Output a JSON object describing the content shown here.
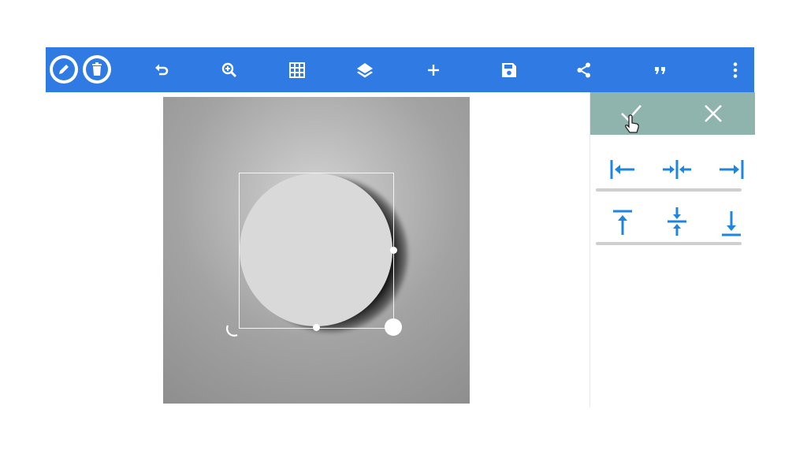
{
  "toolbar": {
    "accent": "#2f7ae3",
    "left_buttons": [
      {
        "name": "edit-button",
        "icon": "pencil-icon"
      },
      {
        "name": "delete-button",
        "icon": "trash-icon"
      }
    ],
    "buttons": [
      {
        "name": "undo-button",
        "icon": "undo-icon"
      },
      {
        "name": "zoom-button",
        "icon": "zoom-in-icon"
      },
      {
        "name": "grid-button",
        "icon": "grid-icon"
      },
      {
        "name": "layers-button",
        "icon": "layers-icon"
      },
      {
        "name": "add-button",
        "icon": "plus-icon"
      },
      {
        "name": "save-button",
        "icon": "save-icon"
      },
      {
        "name": "share-button",
        "icon": "share-icon"
      },
      {
        "name": "quote-button",
        "icon": "quote-icon"
      },
      {
        "name": "more-button",
        "icon": "more-vertical-icon"
      }
    ]
  },
  "canvas": {
    "object": "circle-shape",
    "shadow": true
  },
  "align_panel": {
    "header_color": "#8fb3ad",
    "confirm_icon": "check-icon",
    "cancel_icon": "close-icon",
    "horizontal": [
      {
        "name": "align-left-button",
        "icon": "align-left-icon"
      },
      {
        "name": "align-center-horizontal-button",
        "icon": "align-center-horizontal-icon"
      },
      {
        "name": "align-right-button",
        "icon": "align-right-icon"
      }
    ],
    "vertical": [
      {
        "name": "align-top-button",
        "icon": "align-top-icon"
      },
      {
        "name": "align-center-vertical-button",
        "icon": "align-center-vertical-icon"
      },
      {
        "name": "align-bottom-button",
        "icon": "align-bottom-icon"
      }
    ]
  }
}
